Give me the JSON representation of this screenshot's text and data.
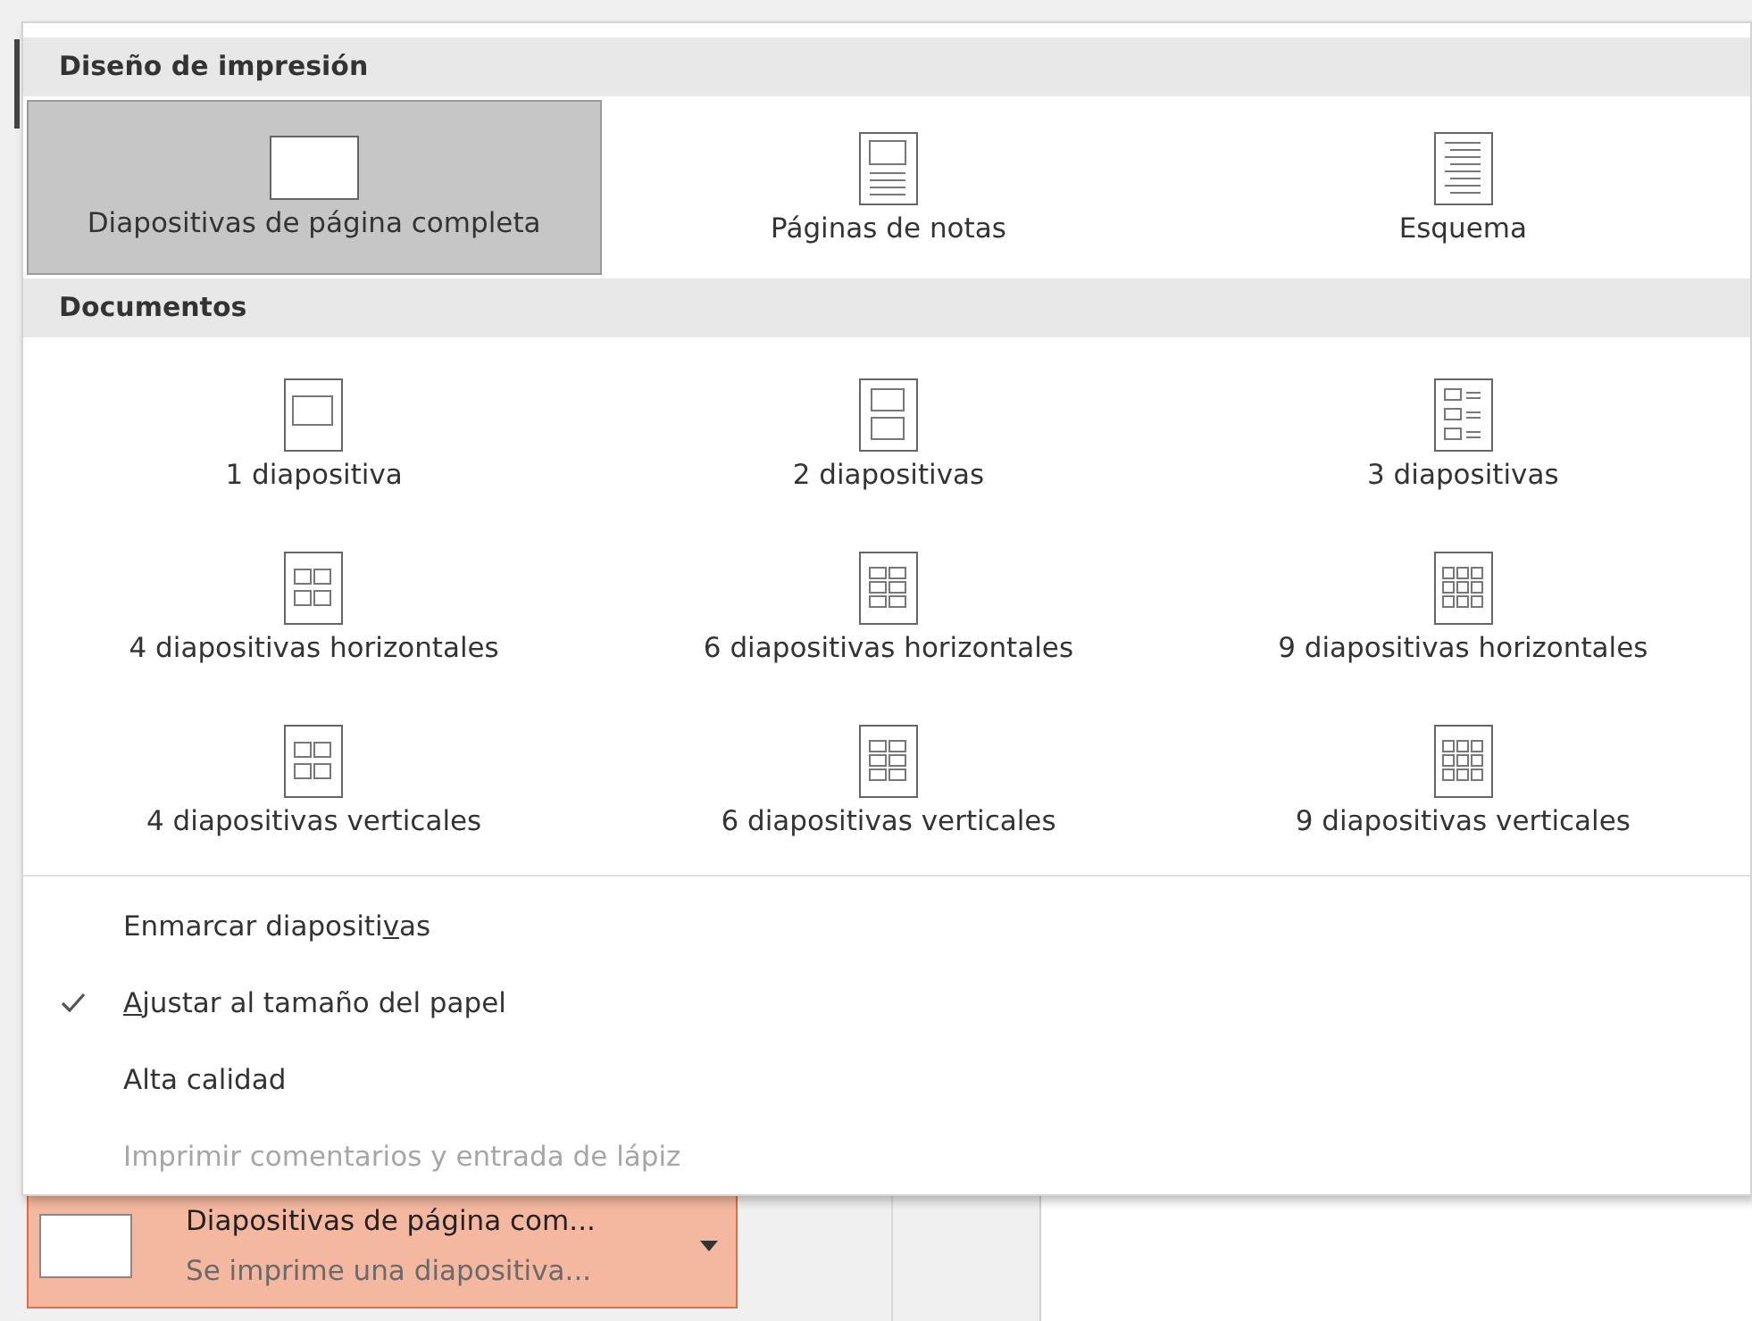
{
  "print_layout": {
    "title": "Diseño de impresión",
    "items": [
      {
        "label": "Diapositivas de página completa",
        "kind": "full",
        "selected": true
      },
      {
        "label": "Páginas de notas",
        "kind": "notes",
        "selected": false
      },
      {
        "label": "Esquema",
        "kind": "outline",
        "selected": false
      }
    ]
  },
  "handouts": {
    "title": "Documentos",
    "items": [
      {
        "label": "1 diapositiva",
        "kind": "h1",
        "selected": false
      },
      {
        "label": "2 diapositivas",
        "kind": "h2",
        "selected": false
      },
      {
        "label": "3 diapositivas",
        "kind": "h3",
        "selected": false
      },
      {
        "label": "4 diapositivas horizontales",
        "kind": "h4",
        "selected": false
      },
      {
        "label": "6 diapositivas horizontales",
        "kind": "h6",
        "selected": false
      },
      {
        "label": "9 diapositivas horizontales",
        "kind": "h9",
        "selected": false
      },
      {
        "label": "4 diapositivas verticales",
        "kind": "h4",
        "selected": false
      },
      {
        "label": "6 diapositivas verticales",
        "kind": "h6",
        "selected": false
      },
      {
        "label": "9 diapositivas verticales",
        "kind": "h9",
        "selected": false
      }
    ]
  },
  "options": [
    {
      "before": "Enmarcar diapositi",
      "key": "v",
      "after": "as",
      "checked": false,
      "disabled": false
    },
    {
      "key": "A",
      "after": "justar al tamaño del papel",
      "checked": true,
      "disabled": false
    },
    {
      "before": "Alta calidad",
      "checked": false,
      "disabled": false
    },
    {
      "before": "Imprimir comentarios y entrada de lápiz",
      "checked": false,
      "disabled": true
    }
  ],
  "dropdown": {
    "title": "Diapositivas de página com...",
    "subtitle": "Se imprime una diapositiva..."
  }
}
